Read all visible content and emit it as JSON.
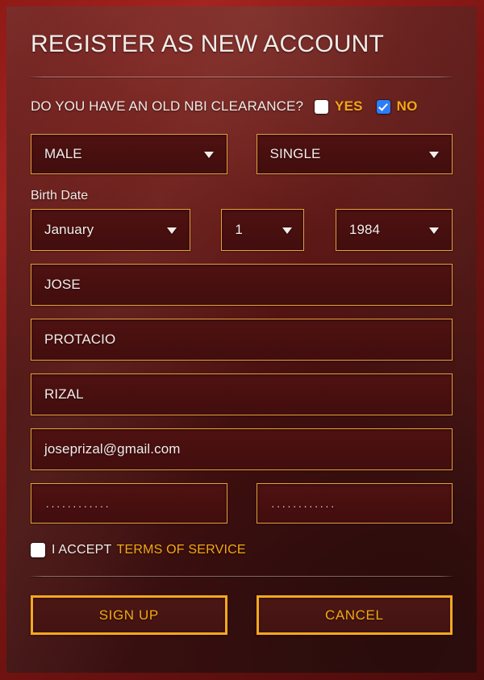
{
  "form": {
    "title": "REGISTER AS NEW ACCOUNT",
    "nbi_question": {
      "label": "DO YOU HAVE AN OLD NBI CLEARANCE?",
      "yes_label": "YES",
      "no_label": "NO",
      "yes_checked": false,
      "no_checked": true
    },
    "gender": {
      "value": "MALE",
      "caret": "chevron-down-icon"
    },
    "civil_status": {
      "value": "SINGLE",
      "caret": "chevron-down-icon"
    },
    "birth_date": {
      "label": "Birth Date",
      "month": "January",
      "day": "1",
      "year": "1984"
    },
    "first_name": {
      "value": "JOSE"
    },
    "middle_name": {
      "value": "PROTACIO"
    },
    "last_name": {
      "value": "RIZAL"
    },
    "email": {
      "value": "joseprizal@gmail.com"
    },
    "password": {
      "value": "............"
    },
    "confirm_password": {
      "value": "............"
    },
    "terms": {
      "accept_text": "I ACCEPT",
      "link_text": "TERMS OF SERVICE",
      "checked": false
    },
    "actions": {
      "submit_label": "SIGN UP",
      "cancel_label": "CANCEL"
    }
  },
  "colors": {
    "accent_orange": "#f5a814",
    "border_orange": "#e8a03c",
    "checkbox_blue": "#2d7dfa",
    "panel_maroon": "#4a1010",
    "frame_red": "#8f1a16",
    "text_white": "#f3ecea"
  }
}
